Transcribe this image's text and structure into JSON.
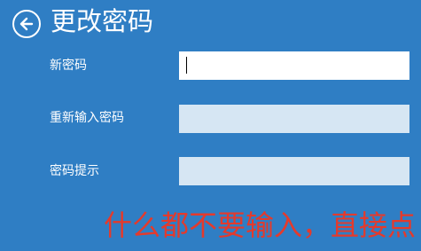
{
  "header": {
    "title": "更改密码",
    "back_icon": "back-arrow-circle-icon"
  },
  "form": {
    "new_password": {
      "label": "新密码",
      "value": "",
      "focused": true
    },
    "retype_password": {
      "label": "重新输入密码",
      "value": ""
    },
    "password_hint": {
      "label": "密码提示",
      "value": ""
    }
  },
  "annotation": {
    "text": "什么都不要输入，直接点",
    "color": "#e43a2c"
  },
  "colors": {
    "background": "#2f7ec4",
    "field_active": "#ffffff",
    "field_inactive": "#d6e6f3"
  }
}
